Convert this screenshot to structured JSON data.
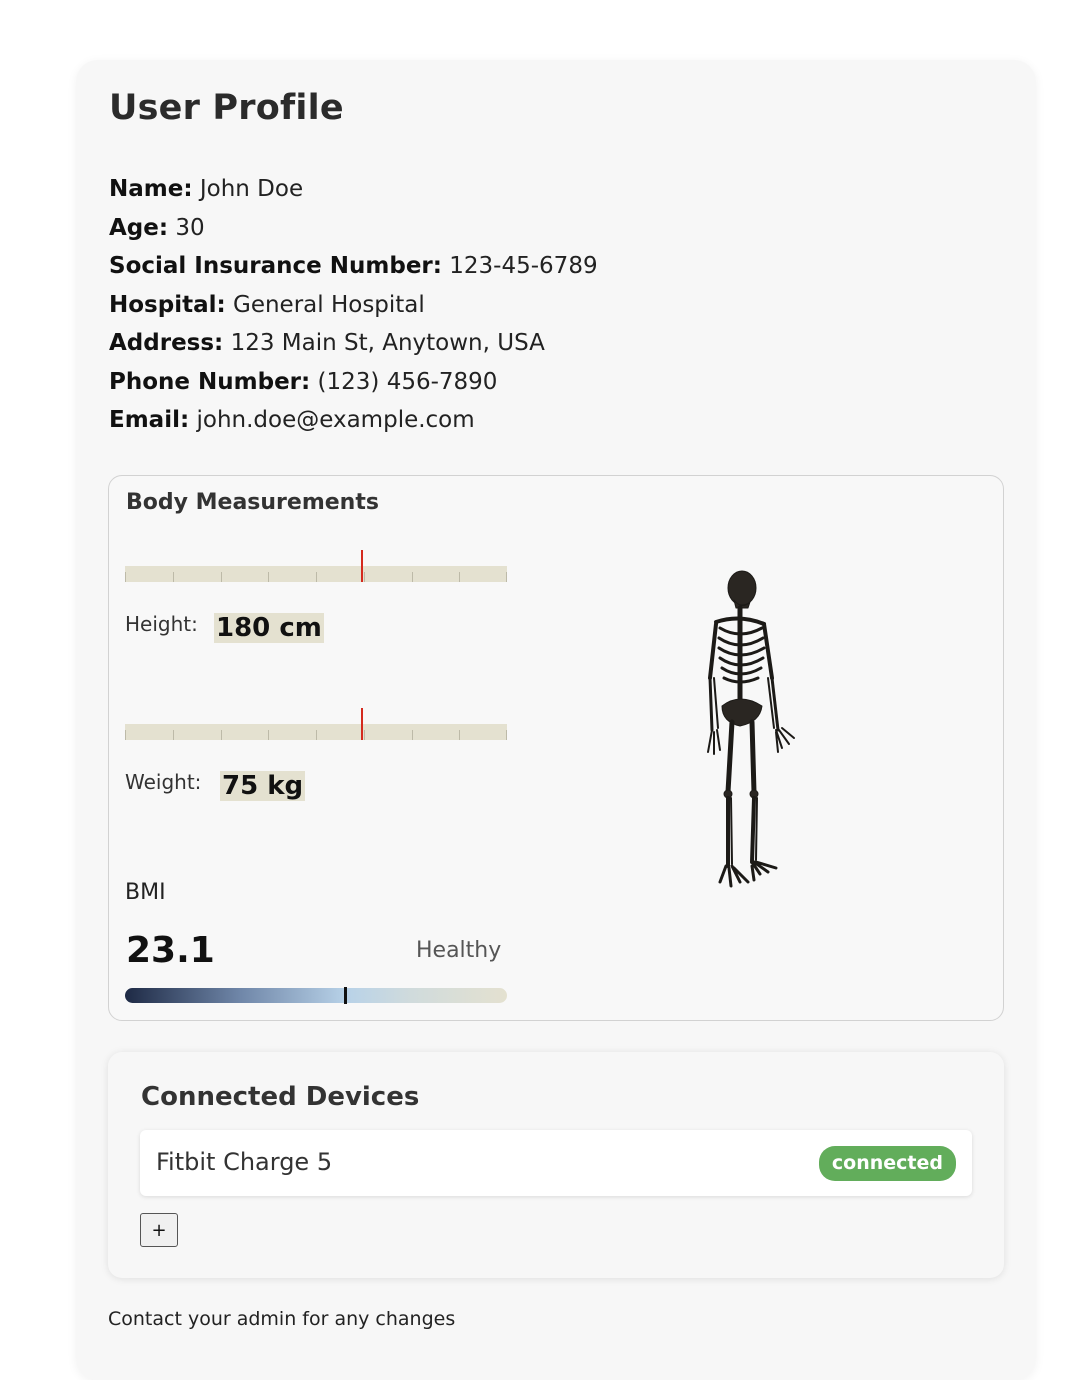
{
  "profile": {
    "title": "User Profile",
    "fields": [
      {
        "label": "Name:",
        "value": "John Doe"
      },
      {
        "label": "Age:",
        "value": "30"
      },
      {
        "label": "Social Insurance Number:",
        "value": "123-45-6789"
      },
      {
        "label": "Hospital:",
        "value": "General Hospital"
      },
      {
        "label": "Address:",
        "value": "123 Main St, Anytown, USA"
      },
      {
        "label": "Phone Number:",
        "value": "(123) 456-7890"
      },
      {
        "label": "Email:",
        "value": "john.doe@example.com"
      }
    ]
  },
  "body": {
    "title": "Body Measurements",
    "height": {
      "label": "Height:",
      "value": "180 cm",
      "marker_fraction": 0.62
    },
    "weight": {
      "label": "Weight:",
      "value": "75 kg",
      "marker_fraction": 0.62
    },
    "bmi": {
      "label": "BMI",
      "value": "23.1",
      "status": "Healthy",
      "marker_fraction": 0.575
    },
    "figure_icon": "skeleton-icon"
  },
  "devices": {
    "title": "Connected Devices",
    "items": [
      {
        "name": "Fitbit Charge 5",
        "status": "connected"
      }
    ],
    "add_label": "+"
  },
  "footer": "Contact your admin for any changes",
  "colors": {
    "marker": "#d42a1e",
    "ruler": "#e4e1d0",
    "connected": "#62ad5b"
  }
}
